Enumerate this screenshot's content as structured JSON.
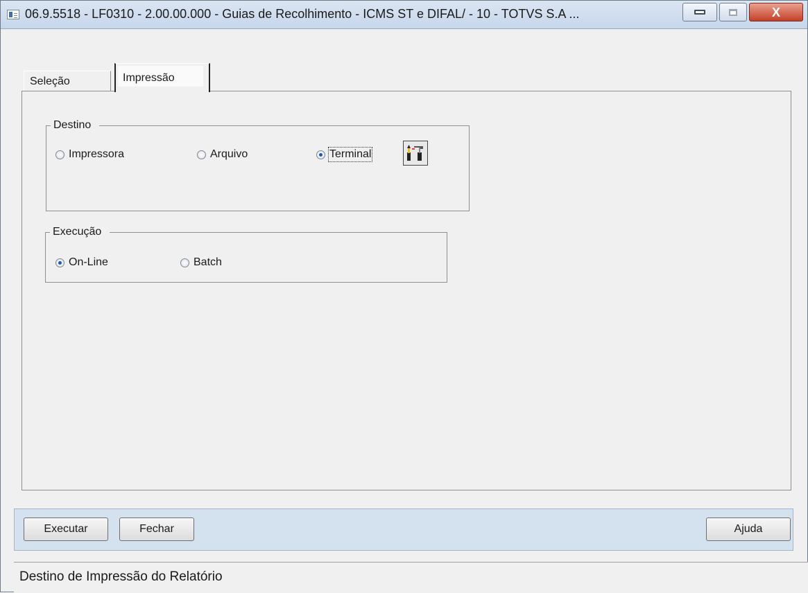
{
  "window": {
    "title": "06.9.5518 - LF0310 - 2.00.00.000 - Guias de Recolhimento - ICMS ST e DIFAL/ - 10 - TOTVS S.A ...",
    "icon": "app-window-icon",
    "close_glyph": "X"
  },
  "tabs": [
    {
      "label": "Seleção",
      "active": false
    },
    {
      "label": "Impressão",
      "active": true
    }
  ],
  "destino": {
    "legend": "Destino",
    "options": [
      {
        "label": "Impressora",
        "checked": false
      },
      {
        "label": "Arquivo",
        "checked": false
      },
      {
        "label": "Terminal",
        "checked": true
      }
    ],
    "config_icon": "tools-icon"
  },
  "execucao": {
    "legend": "Execução",
    "options": [
      {
        "label": "On-Line",
        "checked": true
      },
      {
        "label": "Batch",
        "checked": false
      }
    ]
  },
  "buttons": {
    "executar": "Executar",
    "fechar": "Fechar",
    "ajuda": "Ajuda"
  },
  "status": {
    "text": "Destino de Impressão do Relatório"
  },
  "colors": {
    "button_bar": "#d4e1ef",
    "radio_checked": "#1c5ab0",
    "background": "#f0f0f0"
  }
}
